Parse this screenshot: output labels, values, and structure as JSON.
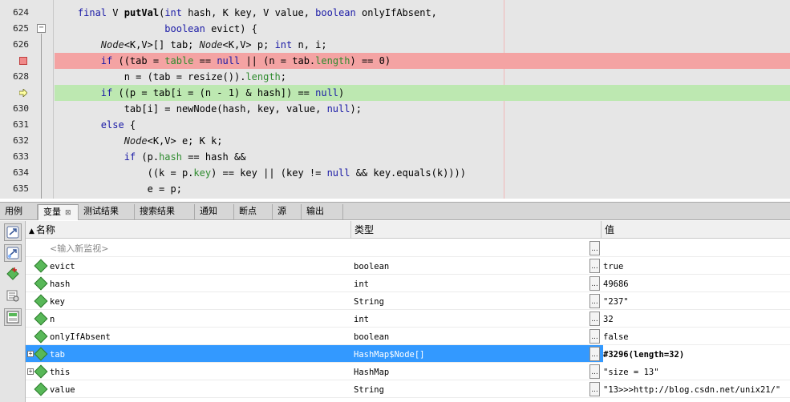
{
  "editor": {
    "lines": [
      {
        "num": "624",
        "tokens": [
          [
            "",
            "    "
          ],
          [
            "kw",
            "final"
          ],
          [
            "",
            " V "
          ],
          [
            "bold",
            "putVal"
          ],
          [
            "",
            "("
          ],
          [
            "kw",
            "int"
          ],
          [
            "",
            " hash, K key, V value, "
          ],
          [
            "kw",
            "boolean"
          ],
          [
            "",
            " onlyIfAbsent,"
          ]
        ]
      },
      {
        "num": "625",
        "tokens": [
          [
            "",
            "                   "
          ],
          [
            "kw",
            "boolean"
          ],
          [
            "",
            " evict) {"
          ]
        ]
      },
      {
        "num": "626",
        "tokens": [
          [
            "",
            "        "
          ],
          [
            "ty",
            "Node"
          ],
          [
            "",
            "<K,V>[] tab; "
          ],
          [
            "ty",
            "Node"
          ],
          [
            "",
            "<K,V> p; "
          ],
          [
            "kw",
            "int"
          ],
          [
            "",
            " n, i;"
          ]
        ]
      },
      {
        "num": "",
        "tokens": [
          [
            "",
            "        "
          ],
          [
            "kw",
            "if"
          ],
          [
            "",
            " ((tab = "
          ],
          [
            "fd",
            "table"
          ],
          [
            "",
            " == "
          ],
          [
            "kw",
            "null"
          ],
          [
            "",
            " || (n = tab."
          ],
          [
            "fd",
            "length"
          ],
          [
            "",
            ") == 0)"
          ]
        ]
      },
      {
        "num": "628",
        "tokens": [
          [
            "",
            "            n = (tab = resize())."
          ],
          [
            "fd",
            "length"
          ],
          [
            "",
            ";"
          ]
        ]
      },
      {
        "num": "",
        "tokens": [
          [
            "",
            "        "
          ],
          [
            "kw",
            "if"
          ],
          [
            "",
            " ((p = tab[i = (n - 1) & hash]) == "
          ],
          [
            "kw",
            "null"
          ],
          [
            "",
            ")"
          ]
        ]
      },
      {
        "num": "630",
        "tokens": [
          [
            "",
            "            tab[i] = newNode(hash, key, value, "
          ],
          [
            "kw",
            "null"
          ],
          [
            "",
            ");"
          ]
        ]
      },
      {
        "num": "631",
        "tokens": [
          [
            "",
            "        "
          ],
          [
            "kw",
            "else"
          ],
          [
            "",
            " {"
          ]
        ]
      },
      {
        "num": "632",
        "tokens": [
          [
            "",
            "            "
          ],
          [
            "ty",
            "Node"
          ],
          [
            "",
            "<K,V> e; K k;"
          ]
        ]
      },
      {
        "num": "633",
        "tokens": [
          [
            "",
            "            "
          ],
          [
            "kw",
            "if"
          ],
          [
            "",
            " (p."
          ],
          [
            "fd",
            "hash"
          ],
          [
            "",
            " == hash &&"
          ]
        ]
      },
      {
        "num": "634",
        "tokens": [
          [
            "",
            "                ((k = p."
          ],
          [
            "fd",
            "key"
          ],
          [
            "",
            ") == key || (key != "
          ],
          [
            "kw",
            "null"
          ],
          [
            "",
            " && key.equals(k))))"
          ]
        ]
      },
      {
        "num": "635",
        "tokens": [
          [
            "",
            "                e = p;"
          ]
        ]
      }
    ]
  },
  "tabs": [
    {
      "label": "用例"
    },
    {
      "label": "变量",
      "closable": true,
      "close_glyph": "⊠"
    },
    {
      "label": "测试结果"
    },
    {
      "label": "搜索结果"
    },
    {
      "label": "通知"
    },
    {
      "label": "断点"
    },
    {
      "label": "源"
    },
    {
      "label": "输出"
    }
  ],
  "variables": {
    "columns": {
      "name": "名称",
      "type": "类型",
      "value": "值"
    },
    "watch_placeholder": "<输入新监视>",
    "rows": [
      {
        "name": "evict",
        "type": "boolean",
        "value": "true",
        "expandable": false,
        "selected": false
      },
      {
        "name": "hash",
        "type": "int",
        "value": "49686",
        "expandable": false,
        "selected": false
      },
      {
        "name": "key",
        "type": "String",
        "value": "\"237\"",
        "expandable": false,
        "selected": false
      },
      {
        "name": "n",
        "type": "int",
        "value": "32",
        "expandable": false,
        "selected": false
      },
      {
        "name": "onlyIfAbsent",
        "type": "boolean",
        "value": "false",
        "expandable": false,
        "selected": false
      },
      {
        "name": "tab",
        "type": "HashMap$Node[]",
        "value": "#3296(length=32)",
        "expandable": true,
        "selected": true
      },
      {
        "name": "this",
        "type": "HashMap",
        "value": "\"size = 13\"",
        "expandable": true,
        "selected": false
      },
      {
        "name": "value",
        "type": "String",
        "value": "\"13>>>http://blog.csdn.net/unix21/\"",
        "expandable": false,
        "selected": false
      }
    ],
    "dots_label": "..."
  },
  "colors": {
    "breakpoint_line": "#f4a3a3",
    "current_line": "#bde8b1",
    "selection": "#3399ff"
  }
}
